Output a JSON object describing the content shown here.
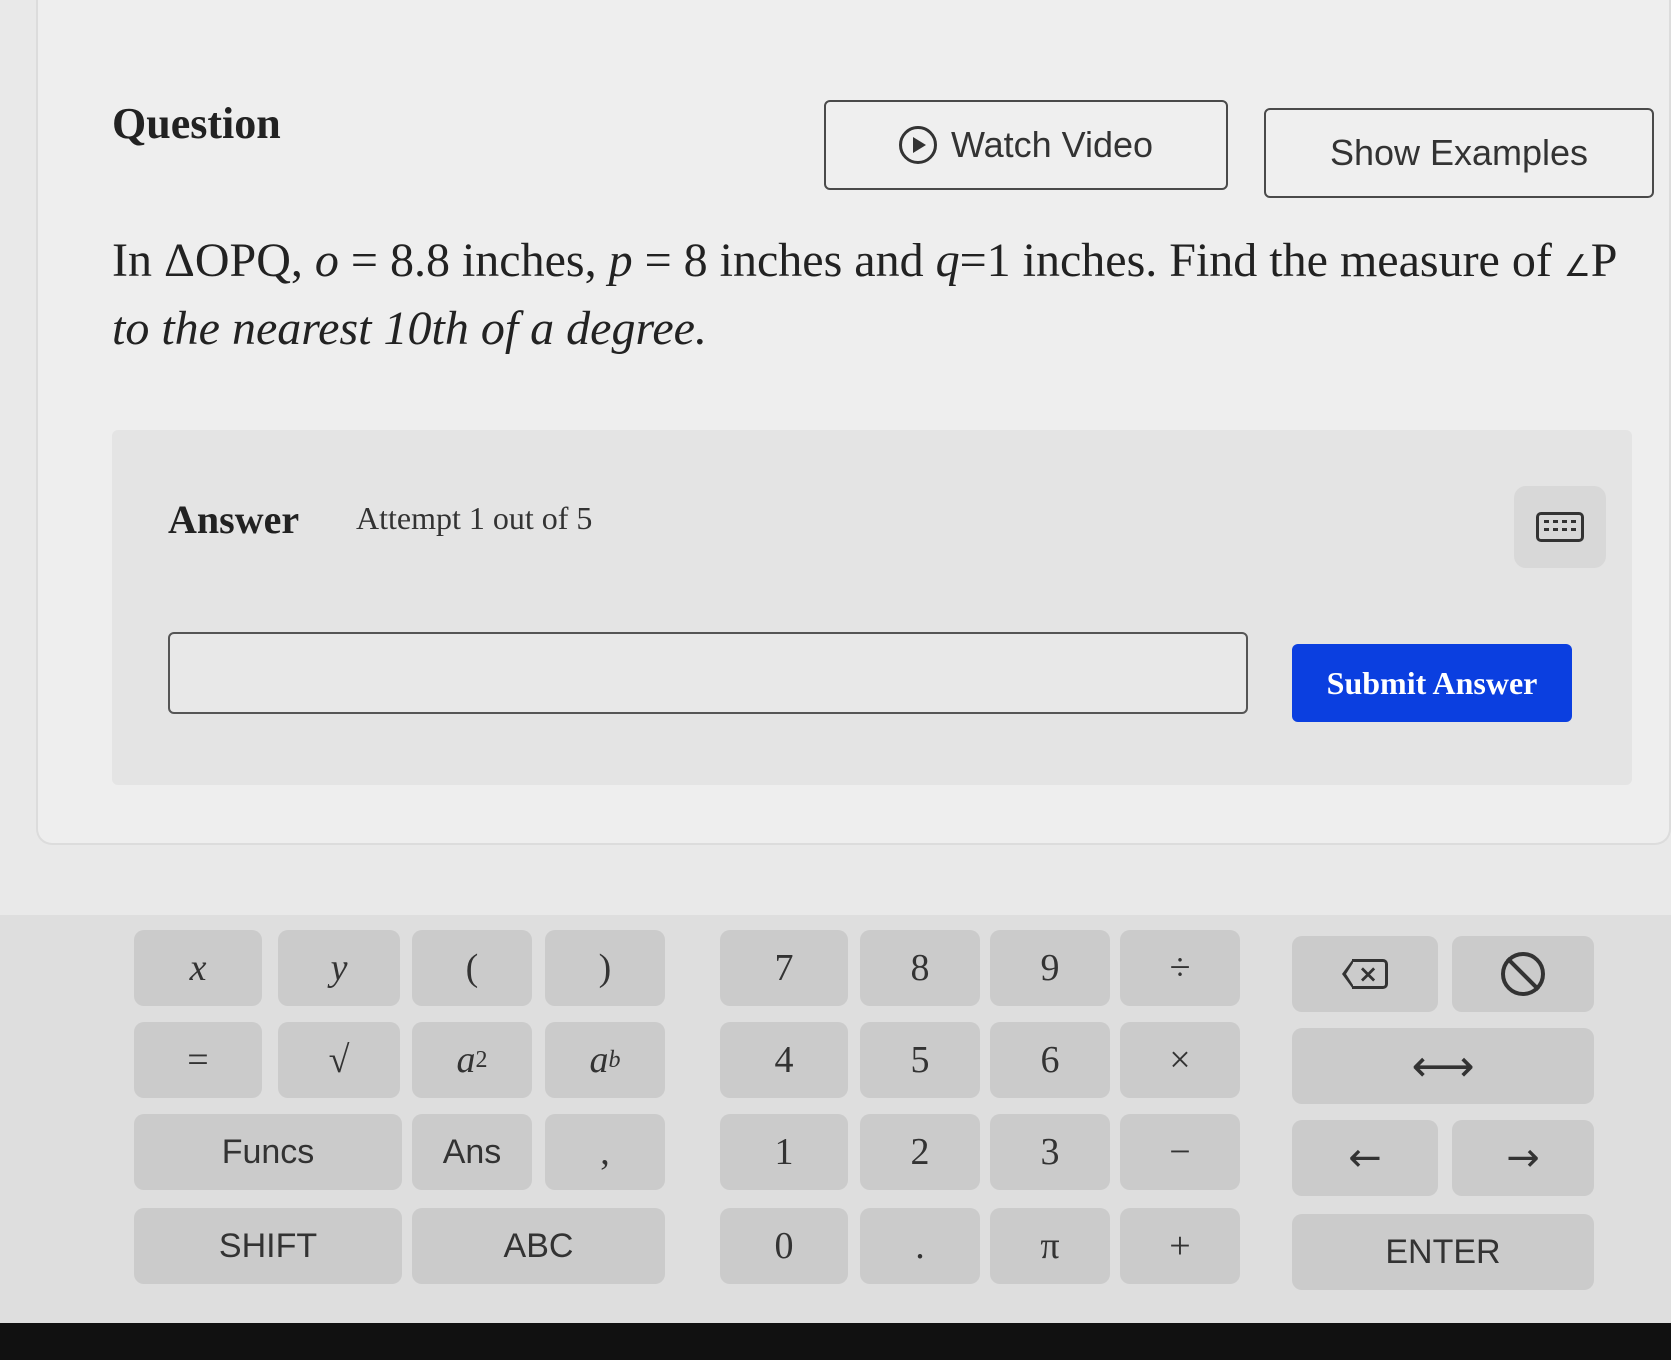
{
  "question": {
    "title": "Question",
    "watch_video_label": "Watch Video",
    "show_examples_label": "Show Examples",
    "problem_part1": "In ΔOPQ, ",
    "o_var": "o",
    "problem_part2": " = 8.8 inches, ",
    "p_var": "p",
    "problem_part3": " = 8 inches and ",
    "q_var": "q",
    "problem_part4": "=1 inches. Find the measure of ",
    "angle_symbol": "∠",
    "problem_part5": "P ",
    "problem_part6": "to the nearest 10th of a degree."
  },
  "answer": {
    "label": "Answer",
    "attempt": "Attempt 1 out of 5",
    "input_value": "",
    "submit_label": "Submit Answer"
  },
  "keyboard": {
    "row1": [
      "x",
      "y",
      "(",
      ")",
      "7",
      "8",
      "9",
      "÷"
    ],
    "row2": [
      "=",
      "√",
      "a",
      "2",
      "a",
      "b",
      "4",
      "5",
      "6",
      "×",
      "⟷"
    ],
    "row3": [
      "Funcs",
      "Ans",
      ",",
      "1",
      "2",
      "3",
      "−",
      "←",
      "→"
    ],
    "row4": [
      "SHIFT",
      "ABC",
      "0",
      ".",
      "π",
      "+",
      "ENTER"
    ]
  },
  "colors": {
    "submit": "#0b3fe0",
    "key": "#cbcbcb",
    "card": "#eeeeee"
  },
  "icons": [
    "play-circle-icon",
    "keyboard-icon",
    "backspace-icon",
    "clear-icon"
  ]
}
